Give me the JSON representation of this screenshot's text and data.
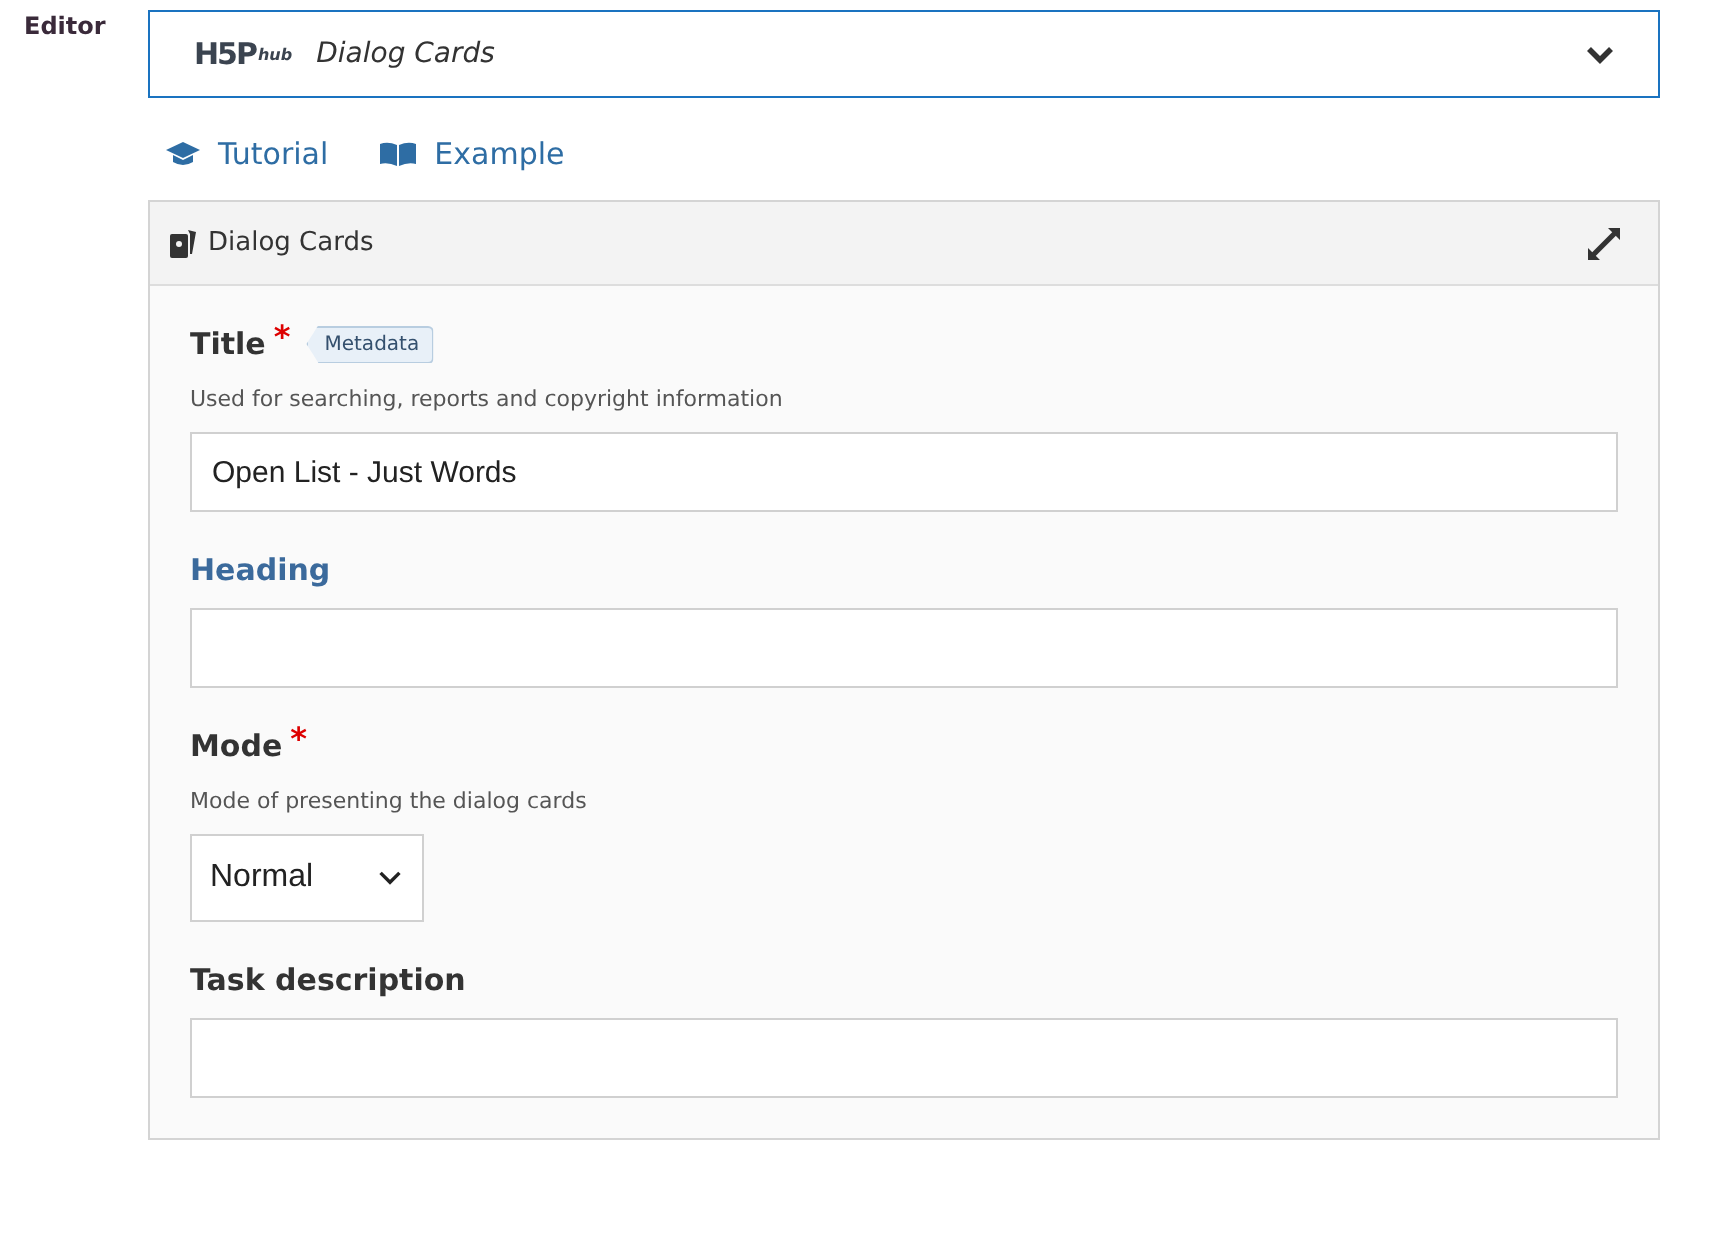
{
  "editor_label": "Editor",
  "library_select": {
    "logo": "H5P",
    "logo_suffix": "hub",
    "value": "Dialog Cards",
    "expanded": false
  },
  "links": [
    {
      "kind": "tutorial",
      "label": "Tutorial"
    },
    {
      "kind": "example",
      "label": "Example"
    }
  ],
  "panel": {
    "title": "Dialog Cards",
    "fields": [
      {
        "kind": "text",
        "label": "Title",
        "required_mark": "*",
        "highlighted": false,
        "badge": "Metadata",
        "description": "Used for searching, reports and copyright information",
        "value": "Open List - Just Words"
      },
      {
        "kind": "text",
        "label": "Heading",
        "highlighted": true
      },
      {
        "kind": "select",
        "label": "Mode",
        "required_mark": "*",
        "highlighted": false,
        "description": "Mode of presenting the dialog cards",
        "value": "Normal"
      },
      {
        "kind": "text",
        "label": "Task description",
        "highlighted": false
      }
    ]
  }
}
